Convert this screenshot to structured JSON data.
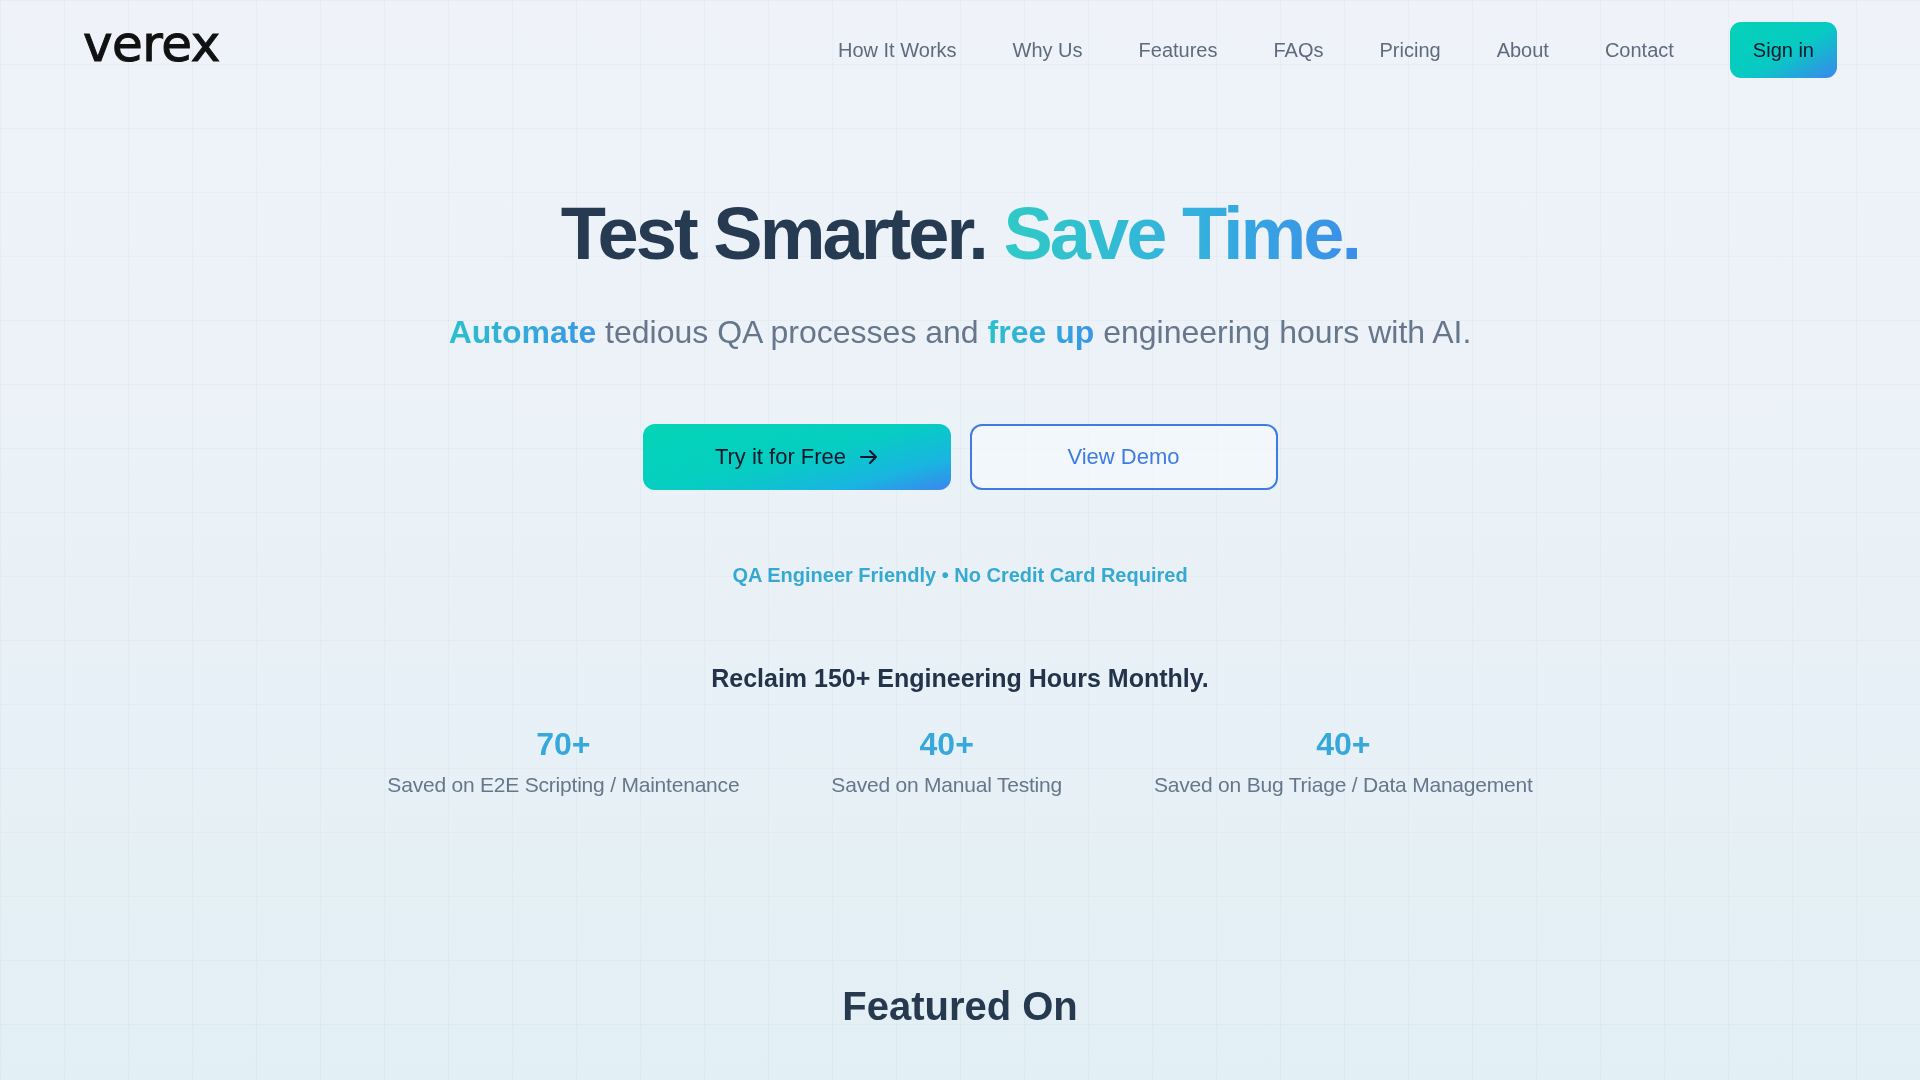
{
  "header": {
    "logo": "verex",
    "nav": [
      "How It Works",
      "Why Us",
      "Features",
      "FAQs",
      "Pricing",
      "About",
      "Contact"
    ],
    "sign_in": "Sign in"
  },
  "hero": {
    "headline": "Test Smarter. **Save Time.**",
    "subtitle": "**Automate** tedious QA processes and **free up** engineering hours with AI.",
    "buttons": [
      {
        "label": "Try it for Free",
        "kind": "primary"
      },
      {
        "label": "View Demo",
        "kind": "outline"
      }
    ],
    "tagline": "QA Engineer Friendly • No Credit Card Required"
  },
  "stats": {
    "title": "Reclaim 150+ Engineering Hours Monthly.",
    "items": [
      {
        "value": "70+",
        "label": "Saved on E2E Scripting / Maintenance"
      },
      {
        "value": "40+",
        "label": "Saved on Manual Testing"
      },
      {
        "value": "40+",
        "label": "Saved on Bug Triage / Data Management"
      }
    ]
  },
  "featured": {
    "title": "Featured On"
  }
}
